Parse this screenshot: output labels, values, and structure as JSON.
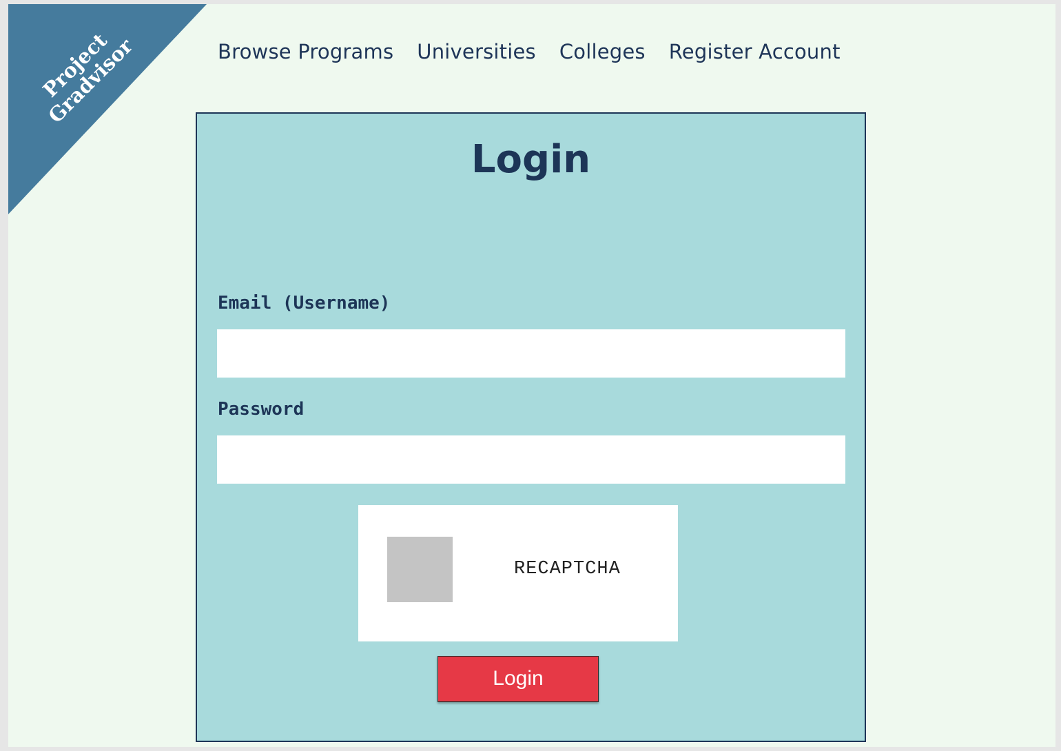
{
  "brand": {
    "line1": "Project",
    "line2": "Gradvisor",
    "color": "#457b9d"
  },
  "nav": {
    "items": [
      {
        "label": "Browse Programs"
      },
      {
        "label": "Universities"
      },
      {
        "label": "Colleges"
      },
      {
        "label": "Register Account"
      }
    ]
  },
  "login": {
    "title": "Login",
    "email_label": "Email (Username)",
    "email_value": "",
    "password_label": "Password",
    "password_value": "",
    "captcha_label": "RECAPTCHA",
    "submit_label": "Login"
  },
  "colors": {
    "page_background": "#eff9ef",
    "panel_background": "#a8dadc",
    "text_dark": "#1d3557",
    "button": "#e63946"
  }
}
